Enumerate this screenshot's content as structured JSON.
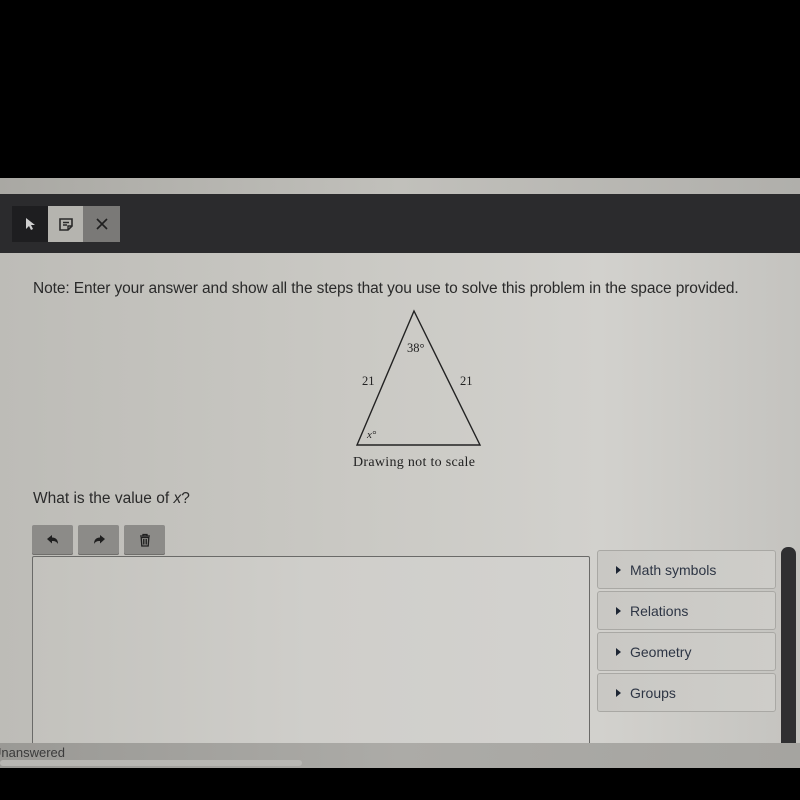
{
  "toolbar": {
    "tools": [
      {
        "name": "pointer",
        "icon": "pointer-icon",
        "state": "default"
      },
      {
        "name": "note",
        "icon": "note-icon",
        "state": "selected"
      },
      {
        "name": "close",
        "icon": "close-icon",
        "state": "default"
      }
    ]
  },
  "question": {
    "note": "Note: Enter your answer and show all the steps that you use to solve this problem in the space provided.",
    "figure": {
      "apex_angle": "38°",
      "left_side": "21",
      "right_side": "21",
      "base_angle": "x°",
      "caption": "Drawing not to scale"
    },
    "prompt_prefix": "What is the value of ",
    "prompt_var": "x",
    "prompt_suffix": "?"
  },
  "editor": {
    "buttons": [
      {
        "name": "undo",
        "icon": "undo-icon"
      },
      {
        "name": "redo",
        "icon": "redo-icon"
      },
      {
        "name": "clear",
        "icon": "trash-icon"
      }
    ],
    "answer_value": ""
  },
  "palette": {
    "items": [
      {
        "label": "Math symbols"
      },
      {
        "label": "Relations"
      },
      {
        "label": "Geometry"
      },
      {
        "label": "Groups"
      }
    ]
  },
  "status": {
    "text": "Unanswered"
  }
}
